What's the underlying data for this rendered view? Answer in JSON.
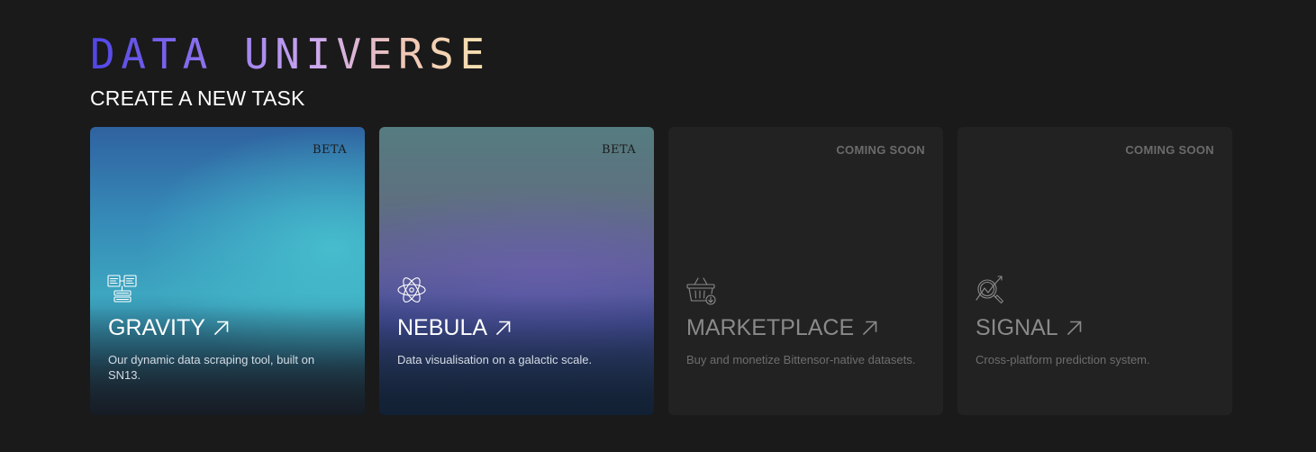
{
  "brand": {
    "title": "DATA UNIVERSE"
  },
  "subtitle": "CREATE A NEW TASK",
  "cards": [
    {
      "title": "GRAVITY",
      "badge": "BETA",
      "description": "Our dynamic data scraping tool, built on SN13.",
      "icon": "data-sources-icon",
      "status": "active"
    },
    {
      "title": "NEBULA",
      "badge": "BETA",
      "description": "Data visualisation on a galactic scale.",
      "icon": "atom-icon",
      "status": "active"
    },
    {
      "title": "MARKETPLACE",
      "badge": "COMING SOON",
      "description": "Buy and monetize Bittensor-native datasets.",
      "icon": "basket-download-icon",
      "status": "disabled"
    },
    {
      "title": "SIGNAL",
      "badge": "COMING SOON",
      "description": "Cross-platform prediction system.",
      "icon": "magnifier-chart-icon",
      "status": "disabled"
    }
  ],
  "colors": {
    "background": "#1a1a1a",
    "brand_gradient": [
      "#4f45e6",
      "#8f74ee",
      "#c9a6f0",
      "#f0c6b6",
      "#f8e3b0"
    ],
    "muted_card": "#222222",
    "muted_text": "#8a8a8a",
    "badge_soon": "#6b6b6b"
  }
}
